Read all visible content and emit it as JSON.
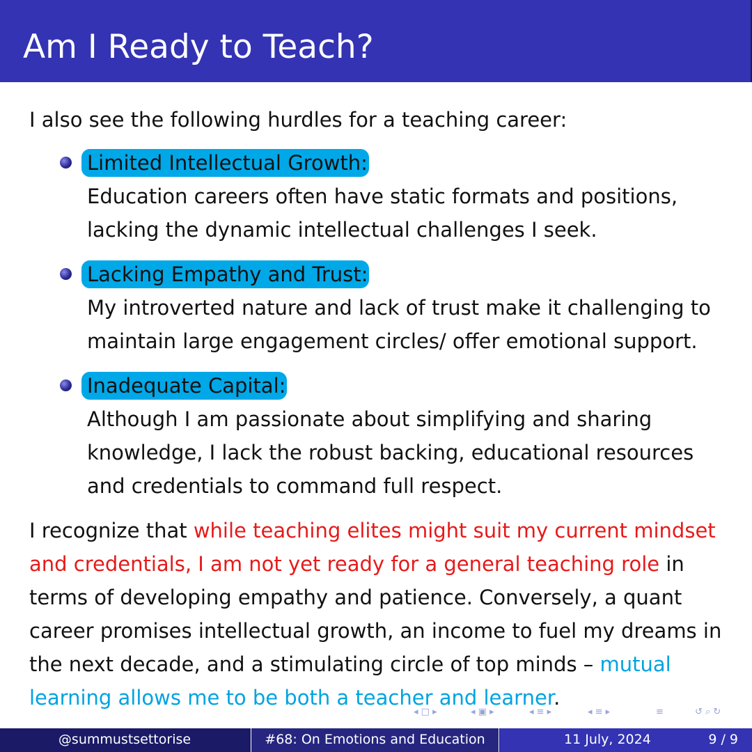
{
  "slide": {
    "title": "Am I Ready to Teach?",
    "intro": "I also see the following hurdles for a teaching career:",
    "items": [
      {
        "heading": "Limited Intellectual Growth",
        "colon": ":",
        "body": "Education careers often have static formats and positions, lacking the dynamic intellectual challenges I seek."
      },
      {
        "heading": "Lacking Empathy and Trust",
        "colon": ":",
        "body": "My introverted nature and lack of trust make it challenging to maintain large engagement circles/ offer emotional support."
      },
      {
        "heading": "Inadequate Capital",
        "colon": ":",
        "body": "Although I am passionate about simplifying and sharing knowledge, I lack the robust backing, educational resources and credentials to command full respect."
      }
    ],
    "conclusion": {
      "part1": "I recognize that ",
      "highlight_red": "while teaching elites might suit my current mindset and credentials, I am not yet ready for a general teaching role",
      "part2": " in terms of developing empathy and patience.  Conversely, a quant career promises intellectual growth, an income to fuel my dreams in the next decade, and a stimulating circle of top minds – ",
      "highlight_cyan": "mutual learning allows me to be both a teacher and learner",
      "end": "."
    }
  },
  "navigation": {
    "icons": [
      "first-slide-icon",
      "frame-icon",
      "section-icon",
      "subsection-icon",
      "appendix-icon",
      "search-icon"
    ],
    "glyphs": [
      "◂ □ ▸",
      "◂ ▣ ▸",
      "◂ ≡ ▸",
      "◂ ≡ ▸",
      "≡",
      "↺ ⌕ ↻"
    ]
  },
  "footer": {
    "author": "@summustsettorise",
    "talk_title": "#68: On Emotions and Education",
    "date": "11 July, 2024",
    "page": "9 / 9"
  },
  "colors": {
    "title_bar": "#3333b3",
    "heading_highlight": "#00a8e8",
    "red_text": "#e61a1a",
    "cyan_text": "#00a3e0",
    "footer_dark": "#1a1a66"
  }
}
